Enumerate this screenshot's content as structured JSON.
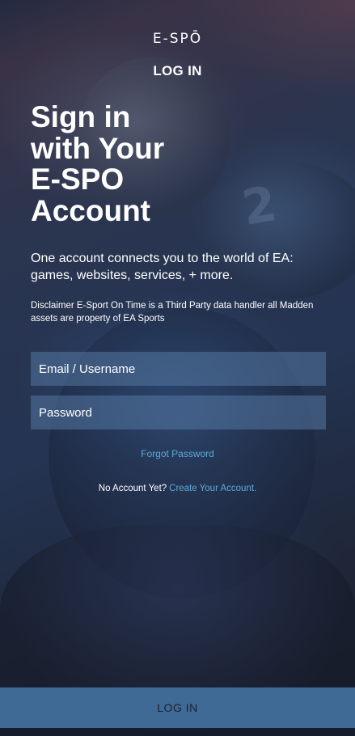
{
  "brand": {
    "logo_text": "E-SPŌ"
  },
  "header": {
    "title": "LOG IN"
  },
  "main": {
    "headline": [
      "Sign in",
      "with Your",
      "E-SPO",
      "Account"
    ],
    "subtitle": "One account connects you to the world of EA: games, websites, services, + more.",
    "disclaimer": "Disclaimer E-Sport On Time is a Third Party data handler all Madden assets are property of EA Sports"
  },
  "form": {
    "email": {
      "value": "",
      "placeholder": "Email / Username"
    },
    "password": {
      "value": "",
      "placeholder": "Password"
    },
    "forgot_password": "Forgot Password",
    "no_account_prompt": "No Account Yet?",
    "create_account": "Create Your Account."
  },
  "footer": {
    "login_button": "LOG IN"
  },
  "colors": {
    "link": "#5fa8d6",
    "field_bg": "#54769f",
    "button_bg": "#3f6a95",
    "background_dark": "#1a2033"
  }
}
